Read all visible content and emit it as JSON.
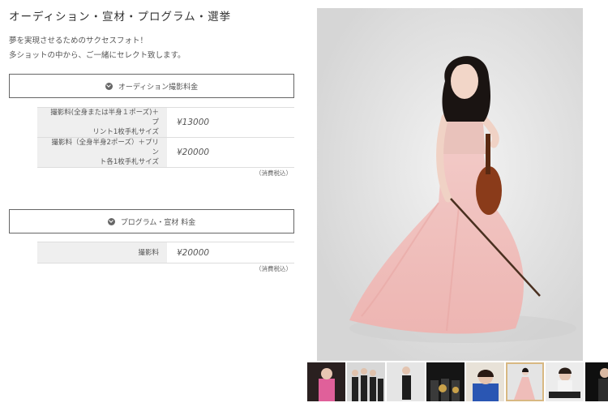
{
  "page": {
    "title": "オーディション・宣材・プログラム・選挙",
    "intro": [
      "夢を実現させるためのサクセスフォト！",
      "多ショットの中から、ご一緒にセレクト致します。"
    ]
  },
  "sections": [
    {
      "heading": "オーディション撮影料金",
      "rows": [
        {
          "label_lines": [
            "撮影料(全身または半身１ポーズ)＋プ",
            "リント1枚手札サイズ"
          ],
          "price": "¥13000"
        },
        {
          "label_lines": [
            "撮影料（全身半身2ポーズ）＋プリン",
            "ト各1枚手札サイズ"
          ],
          "price": "¥20000"
        }
      ],
      "tax_note": "（消費税込）"
    },
    {
      "heading": "プログラム・宣材 料金",
      "rows": [
        {
          "label_lines": [
            "撮影料"
          ],
          "price": "¥20000"
        }
      ],
      "tax_note": "（消費税込）"
    }
  ],
  "gallery": {
    "main_photo_subject": "violinist-in-pink-gown",
    "thumbnails": [
      {
        "subject": "woman-in-pink"
      },
      {
        "subject": "group-in-black"
      },
      {
        "subject": "woman-in-black"
      },
      {
        "subject": "brass-band"
      },
      {
        "subject": "singer-in-blue"
      },
      {
        "subject": "violinist-in-pink",
        "active": true
      },
      {
        "subject": "pianist-in-white"
      },
      {
        "subject": "man-in-dark"
      }
    ]
  }
}
